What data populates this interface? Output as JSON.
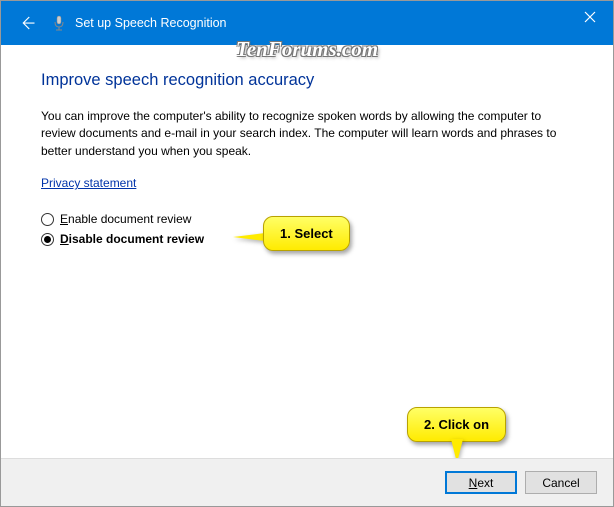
{
  "titlebar": {
    "title": "Set up Speech Recognition"
  },
  "content": {
    "heading": "Improve speech recognition accuracy",
    "body": "You can improve the computer's ability to recognize spoken words by allowing the computer to review documents and e-mail in your search index. The computer will learn words and phrases to better understand you when you speak.",
    "link": "Privacy statement",
    "options": {
      "enable": "nable document review",
      "enable_key": "E",
      "disable": "isable document review",
      "disable_key": "D"
    }
  },
  "buttons": {
    "next": "ext",
    "next_key": "N",
    "cancel": "Cancel"
  },
  "callouts": {
    "one": "1. Select",
    "two": "2. Click on"
  },
  "watermark": "TenForums.com"
}
